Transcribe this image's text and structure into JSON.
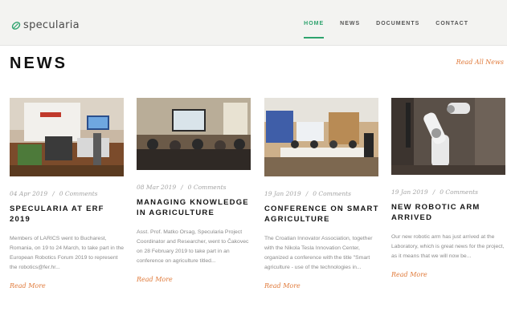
{
  "brand": {
    "name": "specularia",
    "color": "#2ea36e"
  },
  "nav": {
    "items": [
      {
        "label": "HOME",
        "active": true
      },
      {
        "label": "NEWS",
        "active": false
      },
      {
        "label": "DOCUMENTS",
        "active": false
      },
      {
        "label": "CONTACT",
        "active": false
      }
    ]
  },
  "page": {
    "title": "NEWS",
    "read_all": "Read All News"
  },
  "posts": [
    {
      "date": "04 Apr 2019",
      "comments": "0 Comments",
      "title": "SPECULARIA AT ERF 2019",
      "excerpt": "Members of LARICS went to Bucharest, Romania, on 19 to 24 March, to take part in the European Robotics Forum 2019 to represent the robotics@fer.hr...",
      "read_more": "Read More"
    },
    {
      "date": "08 Mar 2019",
      "comments": "0 Comments",
      "title": "MANAGING KNOWLEDGE IN AGRICULTURE",
      "excerpt": "Asst. Prof. Matko Orsag, Specularia Project Coordinator and Researcher, went to Čakovec on 28 February 2019 to take part in an conference on agriculture titled...",
      "read_more": "Read More"
    },
    {
      "date": "19 Jan 2019",
      "comments": "0 Comments",
      "title": "CONFERENCE ON SMART AGRICULTURE",
      "excerpt": "The Croatian Innovator Association, together with the Nikola Tesla Innovation Center, organized a conference with the title \"Smart agriculture - use of the technologies in...",
      "read_more": "Read More"
    },
    {
      "date": "19 Jan 2019",
      "comments": "0 Comments",
      "title": "NEW ROBOTIC ARM ARRIVED",
      "excerpt": "Our new robotic arm has just arrived at the Laboratory, which is great news for the project, as it means that we will now be...",
      "read_more": "Read More"
    }
  ],
  "colors": {
    "accent": "#e07a3a",
    "brand_green": "#2ea36e"
  },
  "icons": {
    "logo": "leaf-icon"
  }
}
